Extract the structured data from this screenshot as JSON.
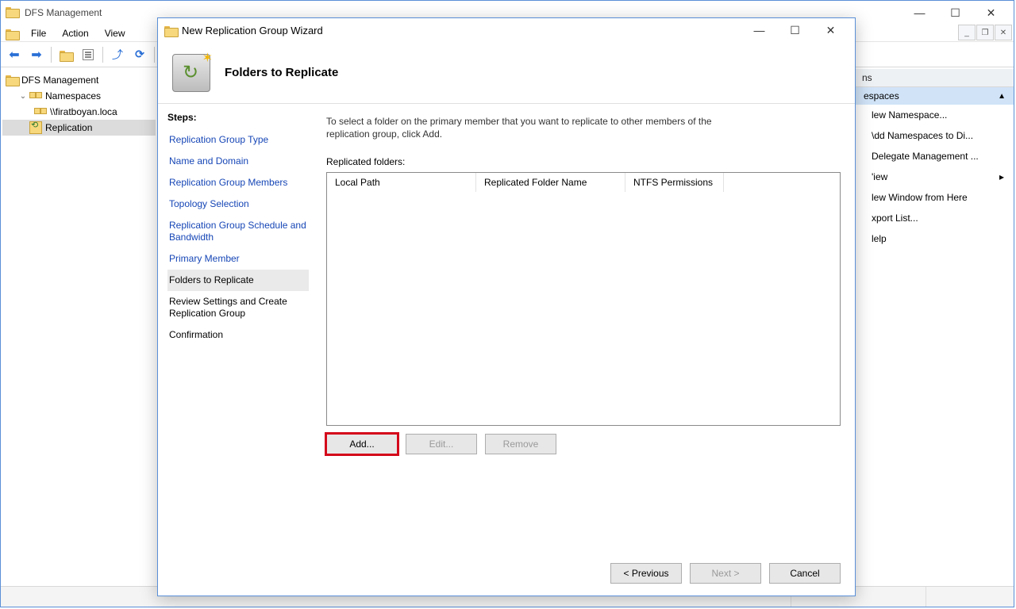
{
  "mmc": {
    "title": "DFS Management",
    "menus": {
      "file": "File",
      "action": "Action",
      "view": "View"
    },
    "tree": {
      "root": "DFS Management",
      "namespaces": "Namespaces",
      "ns_server": "\\\\firatboyan.loca",
      "replication": "Replication"
    },
    "actions": {
      "header_suffix": "ns",
      "group": "espaces",
      "items": {
        "new_namespace": "lew Namespace...",
        "add_namespaces": "\\dd Namespaces to Di...",
        "delegate": "Delegate Management ...",
        "view": "'iew",
        "new_window": "lew Window from Here",
        "export": "xport List...",
        "help": "lelp"
      }
    }
  },
  "wizard": {
    "title": "New Replication Group Wizard",
    "header": "Folders to Replicate",
    "steps_label": "Steps:",
    "steps": {
      "type": "Replication Group Type",
      "name": "Name and Domain",
      "members": "Replication Group Members",
      "topology": "Topology Selection",
      "schedule": "Replication Group Schedule and Bandwidth",
      "primary": "Primary Member",
      "folders": "Folders to Replicate",
      "review": "Review Settings and Create Replication Group",
      "confirm": "Confirmation"
    },
    "desc": "To select a folder on the primary member that you want to replicate to other members of the replication group, click Add.",
    "list_label": "Replicated folders:",
    "columns": {
      "c1": "Local Path",
      "c2": "Replicated Folder Name",
      "c3": "NTFS Permissions"
    },
    "buttons": {
      "add": "Add...",
      "edit": "Edit...",
      "remove": "Remove",
      "previous": "< Previous",
      "next": "Next >",
      "cancel": "Cancel"
    }
  }
}
